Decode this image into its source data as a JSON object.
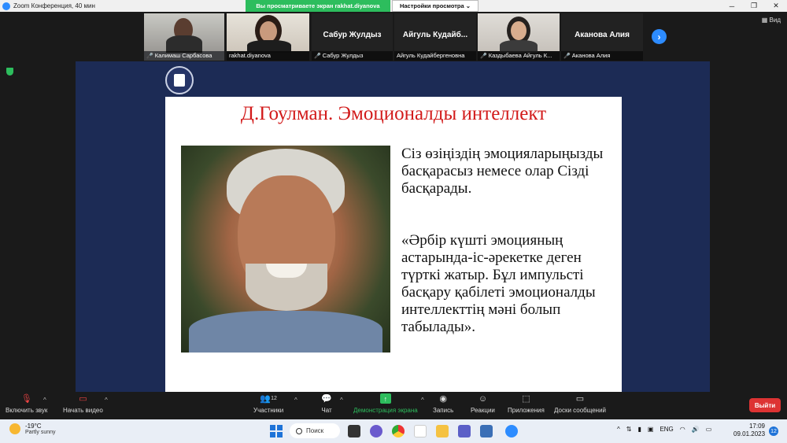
{
  "window": {
    "title": "Zoom Конференция, 40 мин",
    "share_banner": "Вы просматриваете экран rakhat.diyanova",
    "view_settings": "Настройки просмотра ⌄",
    "view_label": "Вид"
  },
  "participants": [
    {
      "caption": "Калимаш Сарбасова",
      "big_name": "",
      "muted": true
    },
    {
      "caption": "rakhat.diyanova",
      "big_name": "",
      "muted": false
    },
    {
      "caption": "Сабур Жулдыз",
      "big_name": "Сабур Жулдыз",
      "muted": true
    },
    {
      "caption": "Айгуль Кудайбергеновна",
      "big_name": "Айгуль Кудайб...",
      "muted": false
    },
    {
      "caption": "Каздыбаева Айгуль К...",
      "big_name": "",
      "muted": true
    },
    {
      "caption": "Аканова Алия",
      "big_name": "Аканова Алия",
      "muted": true
    }
  ],
  "slide": {
    "title": "Д.Гоулман. Эмоционалды интеллект",
    "text1": "Сіз өзіңіздің эмоцияларыңызды басқарасыз немесе олар Сізді басқарады.",
    "text2": "«Әрбір күшті эмоцияның астарында-іс-әрекетке деген түрткі жатыр. Бұл импульсті басқару қабілеті эмоционалды интеллекттің мәні болып табылады»."
  },
  "toolbar": {
    "audio": "Включить звук",
    "video": "Начать видео",
    "participants": "Участники",
    "participants_count": "12",
    "chat": "Чат",
    "share": "Демонстрация экрана",
    "record": "Запись",
    "reactions": "Реакции",
    "apps": "Приложения",
    "whiteboards": "Доски сообщений",
    "leave": "Выйти"
  },
  "taskbar": {
    "temp": "-19°C",
    "weather": "Partly sunny",
    "search": "Поиск",
    "lang": "ENG",
    "time": "17:09",
    "date": "09.01.2023",
    "notifications": "12"
  },
  "colors": {
    "share_green": "#2dbd5d",
    "slide_title_red": "#d21a1a",
    "slide_bg_navy": "#1c2b55",
    "leave_red": "#dd3333"
  }
}
